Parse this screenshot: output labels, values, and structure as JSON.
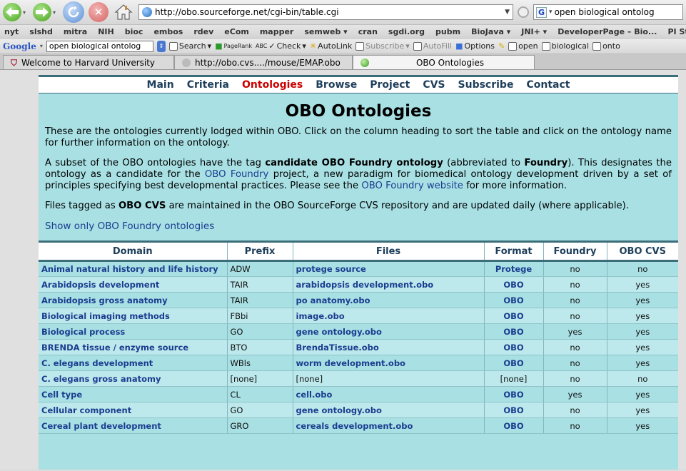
{
  "browser": {
    "url": "http://obo.sourceforge.net/cgi-bin/table.cgi",
    "search_text": "open biological ontolog",
    "search_engine_badge": "G",
    "bookmarks": [
      "nyt",
      "slshd",
      "mitra",
      "NIH",
      "bioc",
      "embos",
      "rdev",
      "eCom",
      "mapper",
      "semweb ▾",
      "cran",
      "sgdi.org",
      "pubm",
      "BioJava ▾",
      "JNI+ ▾",
      "DeveloperPage – Bio...",
      "PI Status"
    ],
    "google_toolbar": {
      "logo": "Google",
      "search_value": "open biological ontolog",
      "search_button": "Search",
      "pagerank": "PageRank",
      "check": "Check",
      "autolink": "AutoLink",
      "subscribe": "Subscribe",
      "autofill": "AutoFill",
      "options": "Options",
      "terms": [
        "open",
        "biological",
        "onto"
      ]
    },
    "tabs": [
      {
        "label": "Welcome to Harvard University",
        "icon": "harvard-shield-icon"
      },
      {
        "label": "http://obo.cvs..../mouse/EMAP.obo",
        "icon": "page-icon"
      },
      {
        "label": "OBO Ontologies",
        "icon": "globe-icon",
        "active": true
      }
    ]
  },
  "page": {
    "nav": [
      "Main",
      "Criteria",
      "Ontologies",
      "Browse",
      "Project",
      "CVS",
      "Subscribe",
      "Contact"
    ],
    "active_nav": "Ontologies",
    "title": "OBO Ontologies",
    "intro": "These are the ontologies currently lodged within OBO. Click on the column heading to sort the table and click on the ontology name for further information on the ontology.",
    "foundry_p": {
      "t1": "A subset of the OBO ontologies have the tag ",
      "b1": "candidate OBO Foundry ontology",
      "t2": " (abbreviated to ",
      "b2": "Foundry",
      "t3": "). This designates the ontology as a candidate for the ",
      "l1": "OBO Foundry",
      "t4": " project, a new paradigm for biomedical ontology development driven by a set of principles specifying best developmental practices. Please see the ",
      "l2": "OBO Foundry website",
      "t5": " for more information."
    },
    "cvs_p": {
      "t1": "Files tagged as ",
      "b1": "OBO CVS",
      "t2": " are maintained in the OBO SourceForge CVS repository and are updated daily (where applicable)."
    },
    "show_only": "Show only OBO Foundry ontologies",
    "table": {
      "headers": [
        "Domain",
        "Prefix",
        "Files",
        "Format",
        "Foundry",
        "OBO CVS"
      ],
      "rows": [
        [
          "Animal natural history and life history",
          "ADW",
          "protege source",
          "Protege",
          "no",
          "no"
        ],
        [
          "Arabidopsis development",
          "TAIR",
          "arabidopsis development.obo",
          "OBO",
          "no",
          "yes"
        ],
        [
          "Arabidopsis gross anatomy",
          "TAIR",
          "po anatomy.obo",
          "OBO",
          "no",
          "yes"
        ],
        [
          "Biological imaging methods",
          "FBbi",
          "image.obo",
          "OBO",
          "no",
          "yes"
        ],
        [
          "Biological process",
          "GO",
          "gene ontology.obo",
          "OBO",
          "yes",
          "yes"
        ],
        [
          "BRENDA tissue / enzyme source",
          "BTO",
          "BrendaTissue.obo",
          "OBO",
          "no",
          "yes"
        ],
        [
          "C. elegans development",
          "WBls",
          "worm development.obo",
          "OBO",
          "no",
          "yes"
        ],
        [
          "C. elegans gross anatomy",
          "[none]",
          "[none]",
          "[none]",
          "no",
          "no"
        ],
        [
          "Cell type",
          "CL",
          "cell.obo",
          "OBO",
          "yes",
          "yes"
        ],
        [
          "Cellular component",
          "GO",
          "gene ontology.obo",
          "OBO",
          "no",
          "yes"
        ],
        [
          "Cereal plant development",
          "GRO",
          "cereals development.obo",
          "OBO",
          "no",
          "yes"
        ]
      ]
    }
  }
}
